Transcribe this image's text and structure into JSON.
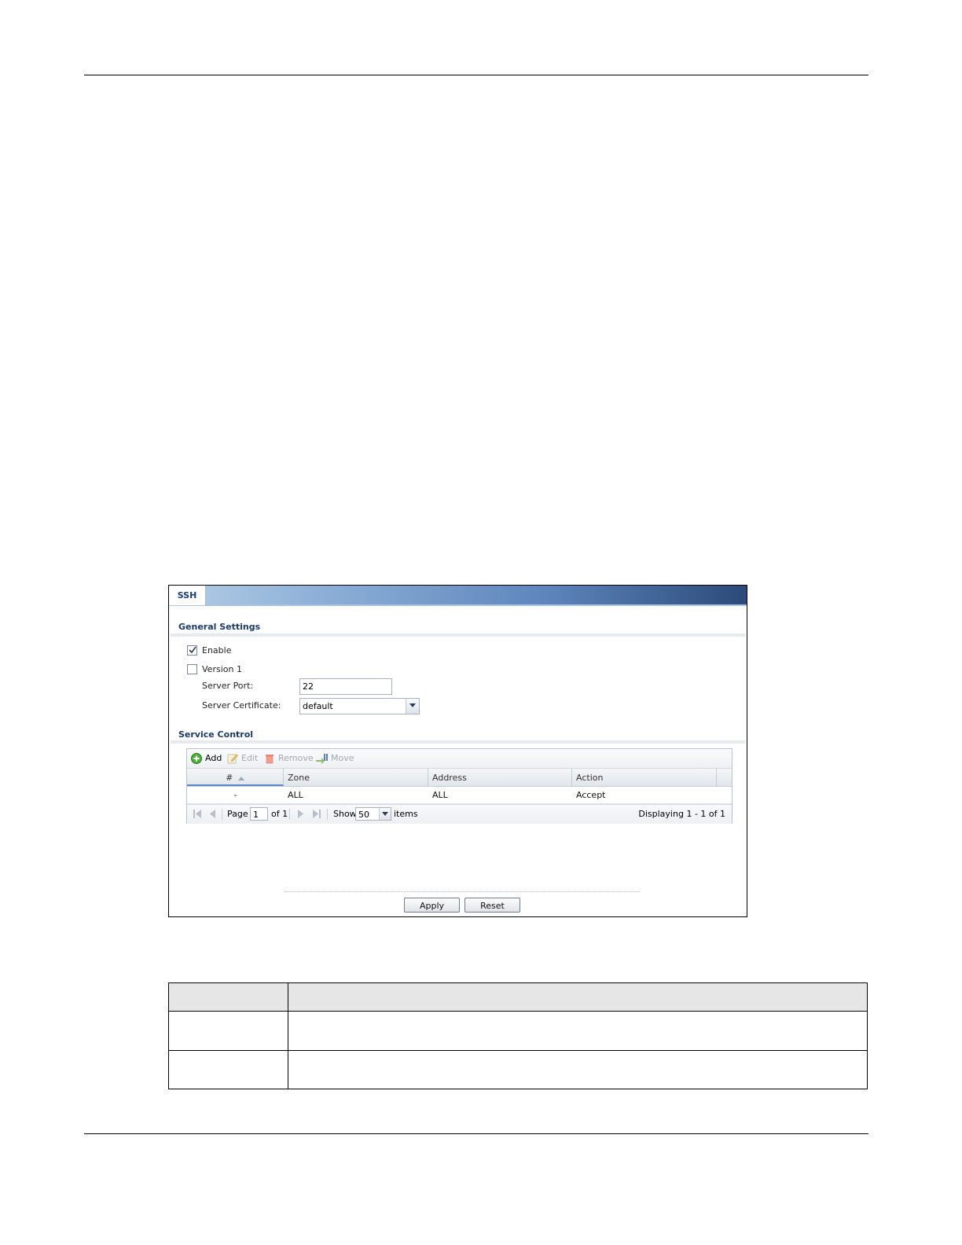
{
  "window": {
    "tab_label": "SSH",
    "general_settings": {
      "title": "General Settings",
      "enable": {
        "label": "Enable",
        "checked": true
      },
      "version1": {
        "label": "Version 1",
        "checked": false
      },
      "server_port": {
        "label": "Server Port:",
        "value": "22"
      },
      "server_certificate": {
        "label": "Server Certificate:",
        "value": "default"
      }
    },
    "service_control": {
      "title": "Service Control",
      "toolbar": {
        "add": "Add",
        "edit": "Edit",
        "remove": "Remove",
        "move": "Move"
      },
      "columns": [
        "#",
        "Zone",
        "Address",
        "Action"
      ],
      "rows": [
        {
          "num": "-",
          "zone": "ALL",
          "address": "ALL",
          "action": "Accept"
        }
      ],
      "pager": {
        "page_label": "Page",
        "page_value": "1",
        "of_label": "of 1",
        "show_label": "Show",
        "show_value": "50",
        "items_label": "items",
        "displaying": "Displaying 1 - 1 of 1"
      }
    },
    "buttons": {
      "apply": "Apply",
      "reset": "Reset"
    }
  },
  "colors": {
    "title_gradient_start": "#b4cde6",
    "title_gradient_end": "#2b4a79",
    "section_title": "#1b3a6b",
    "sort_indicator": "#5b88c6"
  }
}
